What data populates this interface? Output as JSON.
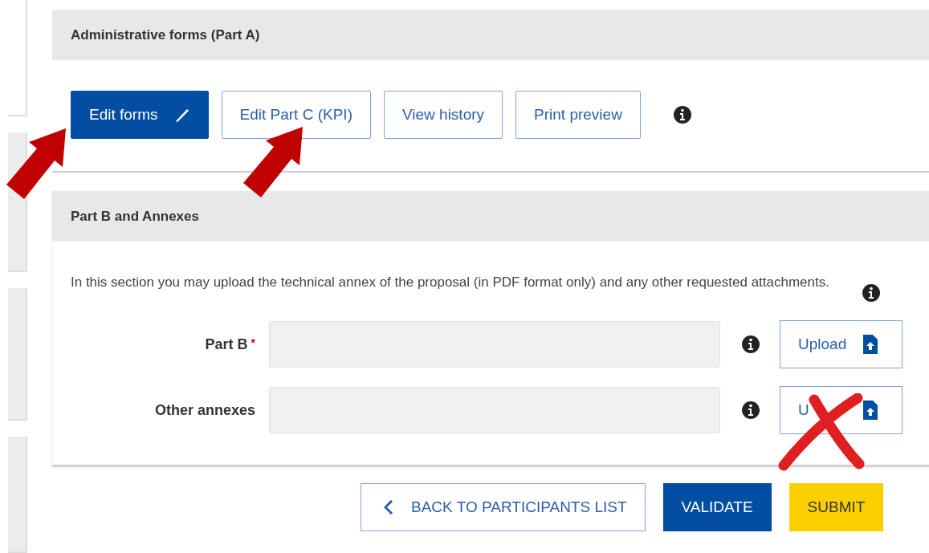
{
  "part_a": {
    "title": "Administrative forms (Part A)",
    "buttons": [
      {
        "label": "Edit forms",
        "kind": "primary"
      },
      {
        "label": "Edit Part C (KPI)",
        "kind": "outline"
      },
      {
        "label": "View history",
        "kind": "outline"
      },
      {
        "label": "Print preview",
        "kind": "outline"
      }
    ]
  },
  "part_b": {
    "title": "Part B and Annexes",
    "description": "In this section you may upload the technical annex of the proposal (in PDF format only) and any other requested attachments.",
    "rows": [
      {
        "label": "Part B",
        "required_mark": "*",
        "button": [
          "Upload"
        ]
      },
      {
        "label": "Other annexes",
        "button": [
          "U"
        ]
      }
    ]
  },
  "footer_buttons": [
    {
      "label": "BACK TO PARTICIPANTS LIST",
      "kind": "back"
    },
    {
      "label": "VALIDATE",
      "kind": "primary"
    },
    {
      "label": "SUBMIT",
      "kind": "submit"
    }
  ]
}
